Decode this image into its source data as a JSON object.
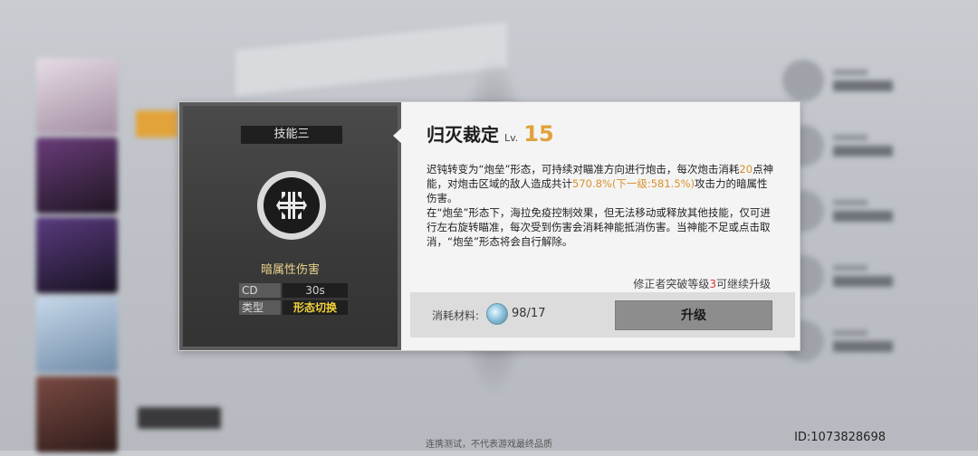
{
  "dialog": {
    "skill_slot": "技能三",
    "skill_icon": "grid-sigil-icon",
    "damage_type": "暗属性伤害",
    "stats": {
      "cd_label": "CD",
      "cd_value": "30s",
      "type_label": "类型",
      "type_value": "形态切换"
    },
    "skill_name": "归灭裁定",
    "level_prefix": "Lv.",
    "level_value": "15",
    "description": {
      "p1": "迟钝转变为“炮垒”形态，可持续对瞄准方向进行炮击，每次炮击消耗",
      "p2_hl": "20",
      "p3": "点神能，对炮击区域的敌人造成共计",
      "p4_hl": "570.8%(下一级:581.5%)",
      "p5": "攻击力的暗属性伤害。",
      "p6": "在“炮垒”形态下，海拉免疫控制效果，但无法移动或释放其他技能，仅可进行左右旋转瞄准，每次受到伤害会消耗神能抵消伤害。当神能不足或点击取消，“炮垒”形态将会自行解除。"
    },
    "upgrade_hint_pre": "修正者突破等级",
    "upgrade_hint_num": "3",
    "upgrade_hint_post": "可继续升级",
    "cost_label": "消耗材料:",
    "cost_item_icon": "crystal-material-icon",
    "cost_count": "98/17",
    "upgrade_button": "升级"
  },
  "footer_note": "连携测试，不代表游戏最终品质",
  "uid": "ID:1073828698",
  "colors": {
    "level_accent": "#e0a23a",
    "highlight_text": "#d9912a",
    "type_value": "#f2d23b",
    "damage_type": "#e8d38a",
    "hint_red": "#d43a3a"
  }
}
